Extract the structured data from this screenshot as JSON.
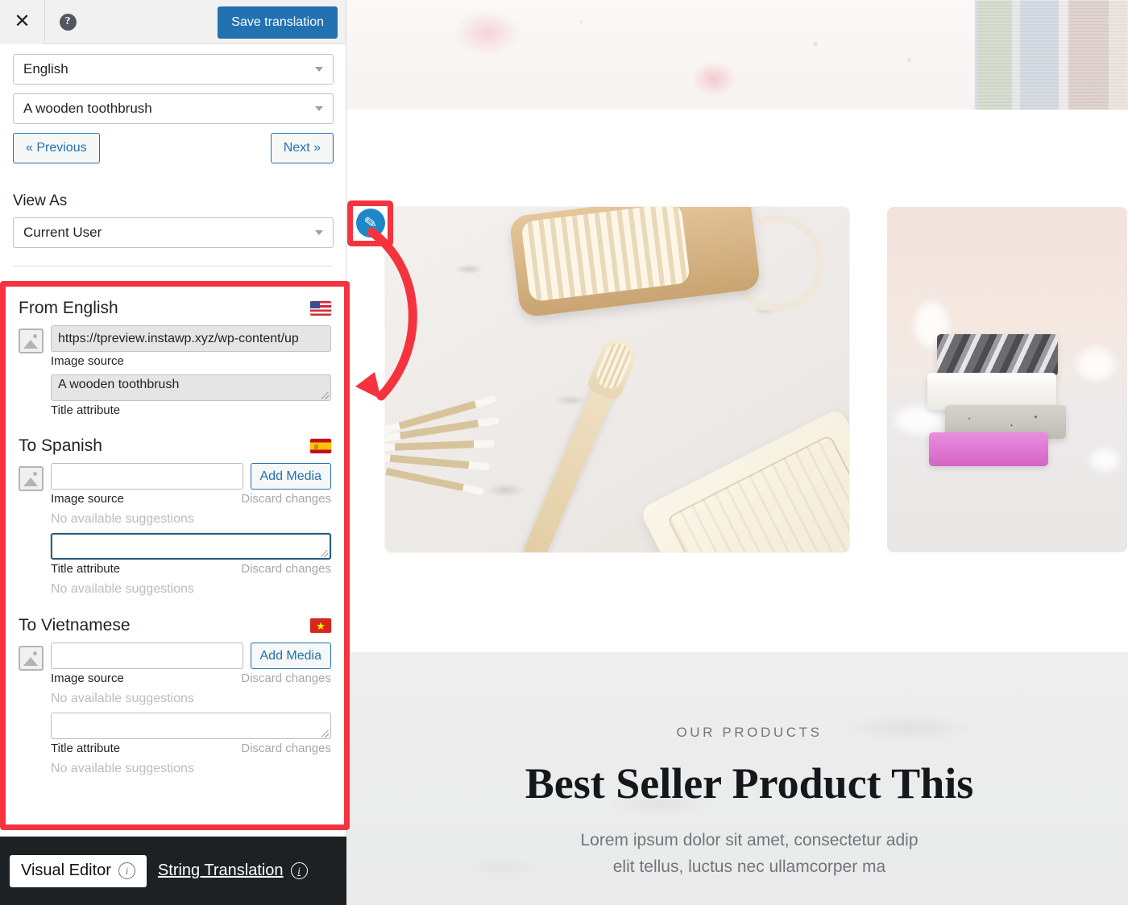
{
  "header": {
    "close_label": "✕",
    "help_label": "?",
    "save_label": "Save translation"
  },
  "controls": {
    "language_select": "English",
    "string_select": "A wooden toothbrush",
    "previous_label": "« Previous",
    "next_label": "Next »",
    "view_as_label": "View As",
    "view_as_select": "Current User"
  },
  "sections": [
    {
      "title": "From English",
      "flag": "us-flag-icon",
      "image_source_value": "https://tpreview.instawp.xyz/wp-content/up",
      "image_source_label": "Image source",
      "title_attr_value": "A wooden toothbrush",
      "title_attr_label": "Title attribute",
      "readonly": true,
      "add_media_label": "",
      "discard_label": "",
      "suggestion_src": "",
      "suggestion_title": ""
    },
    {
      "title": "To Spanish",
      "flag": "es-flag-icon",
      "image_source_value": "",
      "image_source_label": "Image source",
      "title_attr_value": "",
      "title_attr_label": "Title attribute",
      "readonly": false,
      "add_media_label": "Add Media",
      "discard_label": "Discard changes",
      "suggestion_src": "No available suggestions",
      "suggestion_title": "No available suggestions"
    },
    {
      "title": "To Vietnamese",
      "flag": "vn-flag-icon",
      "image_source_value": "",
      "image_source_label": "Image source",
      "title_attr_value": "",
      "title_attr_label": "Title attribute",
      "readonly": false,
      "add_media_label": "Add Media",
      "discard_label": "Discard changes",
      "suggestion_src": "No available suggestions",
      "suggestion_title": "No available suggestions"
    }
  ],
  "footer": {
    "visual_editor_label": "Visual Editor",
    "string_translation_label": "String Translation",
    "info_glyph": "i"
  },
  "preview": {
    "kicker": "OUR PRODUCTS",
    "headline": "Best Seller Product This",
    "subcopy_line1": "Lorem ipsum dolor sit amet, consectetur adip",
    "subcopy_line2": "elit tellus, luctus nec ullamcorper ma"
  },
  "annotation": {
    "pencil_glyph": "✎",
    "highlight_color": "#f5333f",
    "accent_color": "#2271b1",
    "pencil_button_color": "#1e87c6"
  }
}
